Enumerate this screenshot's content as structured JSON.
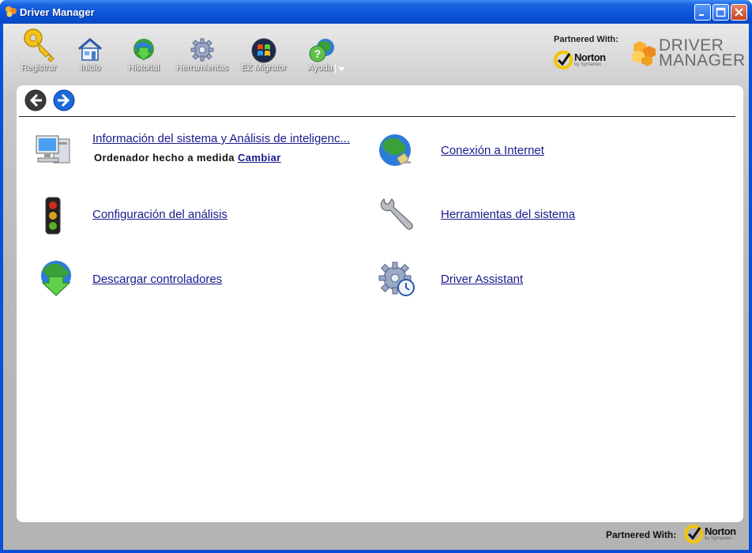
{
  "window": {
    "title": "Driver Manager",
    "controls": [
      "minimize",
      "maximize",
      "close"
    ]
  },
  "toolbar": {
    "items": [
      {
        "label": "Registrar",
        "icon": "key-icon"
      },
      {
        "label": "Inicio",
        "icon": "home-icon"
      },
      {
        "label": "Historial",
        "icon": "history-globe-icon"
      },
      {
        "label": "Herramientas",
        "icon": "gear-icon"
      },
      {
        "label": "EZ Migrator",
        "icon": "windows-logo-icon"
      },
      {
        "label": "Ayuda",
        "icon": "help-icon"
      }
    ]
  },
  "branding": {
    "partnered_with": "Partnered With:",
    "norton_name": "Norton",
    "norton_sub": "by Symantec",
    "logo_line1": "DRIVER",
    "logo_line2": "MANAGER"
  },
  "main": {
    "items": [
      {
        "label": "Información del sistema y Análisis de inteligenc...",
        "icon": "computer-icon"
      },
      {
        "label": "Conexión a Internet",
        "icon": "globe-plug-icon"
      },
      {
        "label": "Configuración del análisis",
        "icon": "traffic-light-icon"
      },
      {
        "label": "Herramientas del sistema",
        "icon": "wrench-icon"
      },
      {
        "label": "Descargar controladores",
        "icon": "download-globe-icon"
      },
      {
        "label": "Driver Assistant",
        "icon": "gear-clock-icon"
      }
    ],
    "subline": {
      "text": "Ordenador hecho a medida",
      "link": "Cambiar"
    }
  },
  "footer": {
    "partnered_with": "Partnered With:",
    "norton_name": "Norton",
    "norton_sub": "by Symantec"
  },
  "colors": {
    "titlebar": "#0a53d8",
    "link": "#1a1a8c",
    "norton_yellow": "#f5c400",
    "logo_orange": "#f0a020"
  }
}
